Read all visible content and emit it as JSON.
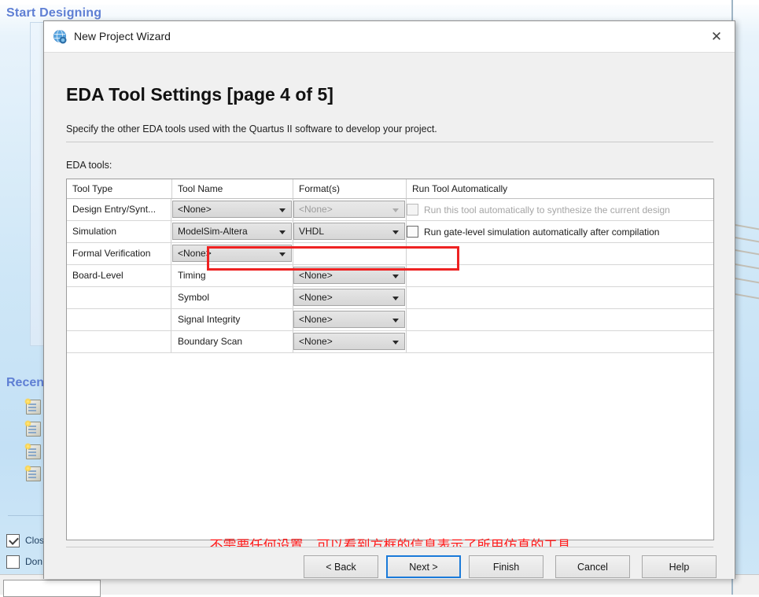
{
  "background": {
    "start_designing": "Start Designing",
    "recent": "Recent",
    "recent_items": [
      "",
      "",
      "",
      ""
    ],
    "checkboxes": [
      {
        "label": "Clos",
        "checked": true
      },
      {
        "label": "Don",
        "checked": false
      }
    ]
  },
  "dialog": {
    "title": "New Project Wizard",
    "title_icon": "quartus-globe-icon",
    "close_icon": "close-icon",
    "page_title": "EDA Tool Settings [page 4 of 5]",
    "description": "Specify the other EDA tools used with the Quartus II software to develop your project.",
    "eda_tools_label": "EDA tools:",
    "annotation": "不需要任何设置，可以看到方框的信息表示了所用仿真的工具",
    "annotation_color": "#ff1a1a",
    "highlight_color": "#ee2222"
  },
  "table": {
    "headers": [
      "Tool Type",
      "Tool Name",
      "Format(s)",
      "Run Tool Automatically"
    ],
    "rows": [
      {
        "tool_type": "Design Entry/Synt...",
        "tool_name": "<None>",
        "tool_name_disabled": false,
        "format": "<None>",
        "format_disabled": true,
        "auto_text": "Run this tool automatically to synthesize the current design",
        "auto_checked": false,
        "auto_disabled": true,
        "highlighted": false
      },
      {
        "tool_type": "Simulation",
        "tool_name": "ModelSim-Altera",
        "tool_name_disabled": false,
        "format": "VHDL",
        "format_disabled": false,
        "auto_text": "Run gate-level simulation automatically after compilation",
        "auto_checked": false,
        "auto_disabled": false,
        "highlighted": true
      },
      {
        "tool_type": "Formal Verification",
        "tool_name": "<None>",
        "tool_name_disabled": false,
        "format": "",
        "format_disabled": false,
        "auto_text": "",
        "auto_checked": false,
        "auto_disabled": false,
        "highlighted": false
      },
      {
        "tool_type": "Board-Level",
        "tool_name": "Timing",
        "tool_name_is_text": true,
        "format": "<None>",
        "format_disabled": false,
        "auto_text": "",
        "auto_checked": false,
        "auto_disabled": false,
        "highlighted": false
      },
      {
        "tool_type": "",
        "tool_name": "Symbol",
        "tool_name_is_text": true,
        "format": "<None>",
        "format_disabled": false,
        "auto_text": "",
        "auto_checked": false,
        "auto_disabled": false,
        "highlighted": false
      },
      {
        "tool_type": "",
        "tool_name": "Signal Integrity",
        "tool_name_is_text": true,
        "format": "<None>",
        "format_disabled": false,
        "auto_text": "",
        "auto_checked": false,
        "auto_disabled": false,
        "highlighted": false
      },
      {
        "tool_type": "",
        "tool_name": "Boundary Scan",
        "tool_name_is_text": true,
        "format": "<None>",
        "format_disabled": false,
        "auto_text": "",
        "auto_checked": false,
        "auto_disabled": false,
        "highlighted": false
      }
    ]
  },
  "footer": {
    "buttons": [
      {
        "label": "< Back",
        "default": false
      },
      {
        "label": "Next >",
        "default": true
      },
      {
        "label": "Finish",
        "default": false
      },
      {
        "label": "Cancel",
        "default": false
      },
      {
        "label": "Help",
        "default": false
      }
    ]
  }
}
